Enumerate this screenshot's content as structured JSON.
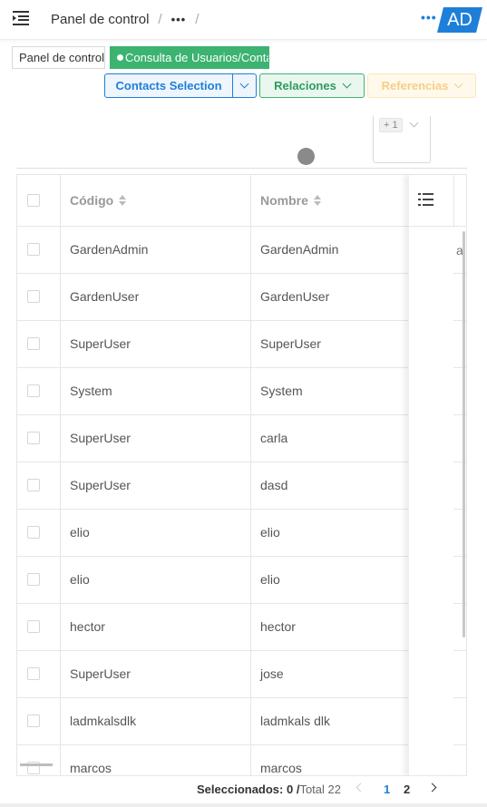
{
  "header": {
    "breadcrumb_root": "Panel de control",
    "breadcrumb_more": "•••",
    "separator": "/",
    "top_more": "•••",
    "avatar_text": "AD"
  },
  "tabs": [
    {
      "label": "Panel de control"
    },
    {
      "label": "Consulta de Usuarios/Contactos"
    }
  ],
  "actions": {
    "contacts_selection": "Contacts Selection",
    "relaciones": "Relaciones",
    "referencias": "Referencias"
  },
  "filter": {
    "tag": "+ 1"
  },
  "table": {
    "columns": [
      {
        "label": "Código"
      },
      {
        "label": "Nombre"
      }
    ],
    "clipped_cell": "alc",
    "rows": [
      {
        "codigo": "GardenAdmin",
        "nombre": "GardenAdmin"
      },
      {
        "codigo": "GardenUser",
        "nombre": "GardenUser"
      },
      {
        "codigo": "SuperUser",
        "nombre": "SuperUser"
      },
      {
        "codigo": "System",
        "nombre": "System"
      },
      {
        "codigo": "SuperUser",
        "nombre": "carla"
      },
      {
        "codigo": "SuperUser",
        "nombre": "dasd"
      },
      {
        "codigo": "elio",
        "nombre": "elio"
      },
      {
        "codigo": "elio",
        "nombre": "elio"
      },
      {
        "codigo": "hector",
        "nombre": "hector"
      },
      {
        "codigo": "SuperUser",
        "nombre": "jose"
      },
      {
        "codigo": "ladmkalsdlk",
        "nombre": "ladmkals dlk"
      },
      {
        "codigo": "marcos",
        "nombre": "marcos"
      }
    ]
  },
  "footer": {
    "selected_label": "Seleccionados: 0 /",
    "total_label": "Total 22",
    "pages": [
      "1",
      "2"
    ],
    "current_page": "1"
  },
  "colors": {
    "primary": "#1e7fd9",
    "success": "#3cb371",
    "warning": "#f5cf86"
  }
}
